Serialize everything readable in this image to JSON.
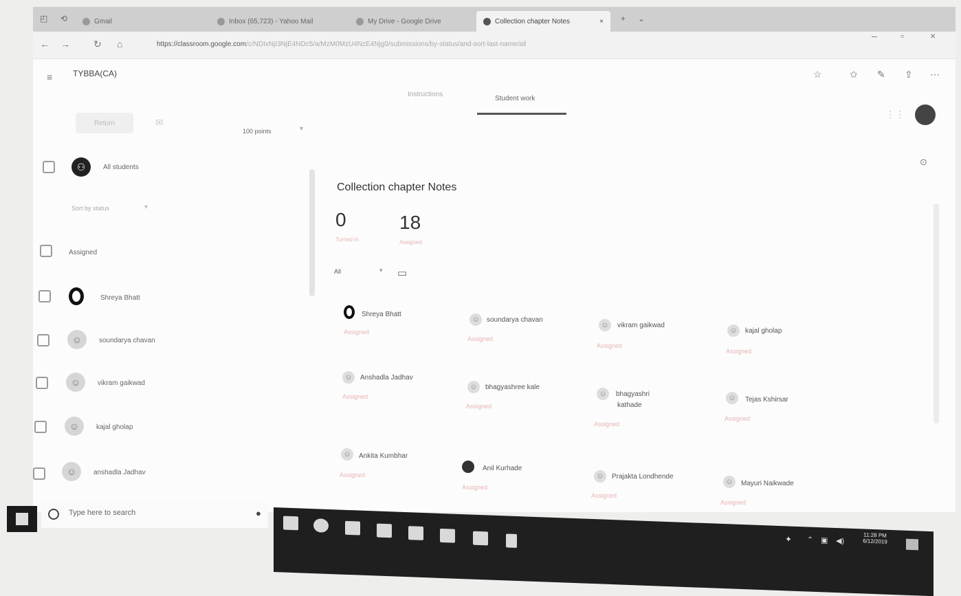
{
  "browser": {
    "tabs": [
      {
        "label": "Gmail"
      },
      {
        "label": "Inbox (65,723) - Yahoo Mail"
      },
      {
        "label": "My Drive - Google Drive"
      },
      {
        "label": "Collection chapter Notes"
      }
    ],
    "url_host": "https://classroom.google.com",
    "url_rest": "/c/NDIxNjI3NjE4NDc5/a/MzM0MzU4NzE4Njg0/submissions/by-status/and-sort-last-name/all"
  },
  "header": {
    "class_name": "TYBBA(CA)",
    "tabs": [
      {
        "label": "Instructions"
      },
      {
        "label": "Student work"
      }
    ]
  },
  "toolbar": {
    "return_label": "Return",
    "points": "100 points"
  },
  "sidebar": {
    "all_students": "All students",
    "sort_label": "Sort by status",
    "group_label": "Assigned",
    "students": [
      {
        "name": "Shreya Bhatt",
        "avatar": "o"
      },
      {
        "name": "soundarya chavan",
        "avatar": "person-icon"
      },
      {
        "name": "vikram gaikwad",
        "avatar": "person-icon"
      },
      {
        "name": "kajal gholap",
        "avatar": "person-icon"
      },
      {
        "name": "anshadla Jadhav",
        "avatar": "person-icon"
      }
    ]
  },
  "main": {
    "title": "Collection chapter Notes",
    "stats": [
      {
        "value": "0",
        "label": "Turned in"
      },
      {
        "value": "18",
        "label": "Assigned"
      }
    ],
    "filter": "All",
    "cards": [
      {
        "name": "Shreya Bhatt",
        "status": "Assigned",
        "avatar": "o"
      },
      {
        "name": "soundarya chavan",
        "status": "Assigned",
        "avatar": "person"
      },
      {
        "name": "vikram gaikwad",
        "status": "Assigned",
        "avatar": "person"
      },
      {
        "name": "kajal gholap",
        "status": "Assigned",
        "avatar": "person"
      },
      {
        "name": "Anshadla Jadhav",
        "status": "Assigned",
        "avatar": "person"
      },
      {
        "name": "bhagyashree kale",
        "status": "Assigned",
        "avatar": "person"
      },
      {
        "name": "bhagyashri",
        "name2": "kathade",
        "status": "Assigned",
        "avatar": "person"
      },
      {
        "name": "Tejas Kshirsar",
        "status": "Assigned",
        "avatar": "person"
      },
      {
        "name": "Ankita Kumbhar",
        "status": "Assigned",
        "avatar": "person"
      },
      {
        "name": "Anil Kurhade",
        "status": "Assigned",
        "avatar": "dark"
      },
      {
        "name": "Prajakta Londhende",
        "status": "Assigned",
        "avatar": "person"
      },
      {
        "name": "Mayuri Naikwade",
        "status": "Assigned",
        "avatar": "person"
      }
    ]
  },
  "taskbar": {
    "search_placeholder": "Type here to search",
    "time": "11:28 PM",
    "date": "6/12/2019"
  }
}
